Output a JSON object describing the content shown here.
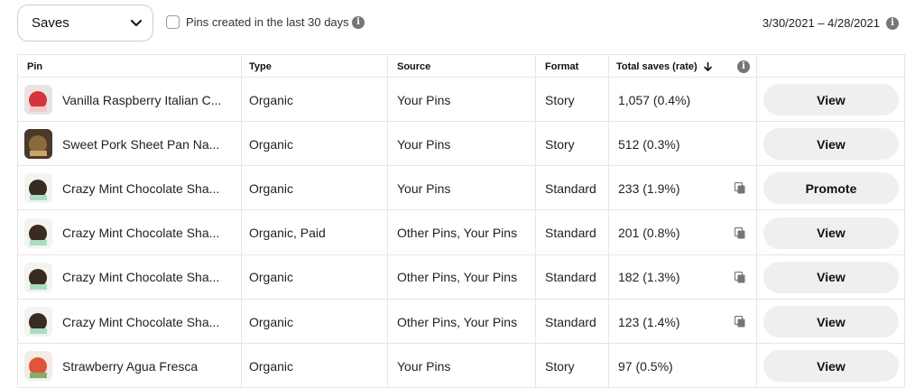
{
  "toolbar": {
    "metric_select": "Saves",
    "filter_label": "Pins created in the last 30 days",
    "date_range": "3/30/2021 – 4/28/2021"
  },
  "table": {
    "headers": {
      "pin": "Pin",
      "type": "Type",
      "source": "Source",
      "format": "Format",
      "total_saves": "Total saves (rate)"
    },
    "rows": [
      {
        "title": "Vanilla Raspberry Italian C...",
        "type": "Organic",
        "source": "Your Pins",
        "format": "Story",
        "saves": "1,057 (0.4%)",
        "duplicate": false,
        "action": "View",
        "thumb_colors": [
          "#e8e4e2",
          "#d8323c",
          "#f2c7c7"
        ]
      },
      {
        "title": "Sweet Pork Sheet Pan Na...",
        "type": "Organic",
        "source": "Your Pins",
        "format": "Story",
        "saves": "512 (0.3%)",
        "duplicate": false,
        "action": "View",
        "thumb_colors": [
          "#4a3a2a",
          "#8b6b3d",
          "#c9a46b"
        ]
      },
      {
        "title": "Crazy Mint Chocolate Sha...",
        "type": "Organic",
        "source": "Your Pins",
        "format": "Standard",
        "saves": "233 (1.9%)",
        "duplicate": true,
        "action": "Promote",
        "thumb_colors": [
          "#f3f3f0",
          "#3a2b22",
          "#a9dcc4"
        ]
      },
      {
        "title": "Crazy Mint Chocolate Sha...",
        "type": "Organic, Paid",
        "source": "Other Pins, Your Pins",
        "format": "Standard",
        "saves": "201 (0.8%)",
        "duplicate": true,
        "action": "View",
        "thumb_colors": [
          "#f3f3f0",
          "#3a2b22",
          "#a9dcc4"
        ]
      },
      {
        "title": "Crazy Mint Chocolate Sha...",
        "type": "Organic",
        "source": "Other Pins, Your Pins",
        "format": "Standard",
        "saves": "182 (1.3%)",
        "duplicate": true,
        "action": "View",
        "thumb_colors": [
          "#f3f3f0",
          "#3a2b22",
          "#a9dcc4"
        ]
      },
      {
        "title": "Crazy Mint Chocolate Sha...",
        "type": "Organic",
        "source": "Other Pins, Your Pins",
        "format": "Standard",
        "saves": "123 (1.4%)",
        "duplicate": true,
        "action": "View",
        "thumb_colors": [
          "#f3f3f0",
          "#3a2b22",
          "#a9dcc4"
        ]
      },
      {
        "title": "Strawberry Agua Fresca",
        "type": "Organic",
        "source": "Your Pins",
        "format": "Story",
        "saves": "97 (0.5%)",
        "duplicate": false,
        "action": "View",
        "thumb_colors": [
          "#f4ece6",
          "#e0543a",
          "#7fb069"
        ]
      }
    ]
  },
  "colors": {
    "button_bg": "#efefef",
    "border": "#e6e6e6",
    "info_icon": "#767676"
  }
}
